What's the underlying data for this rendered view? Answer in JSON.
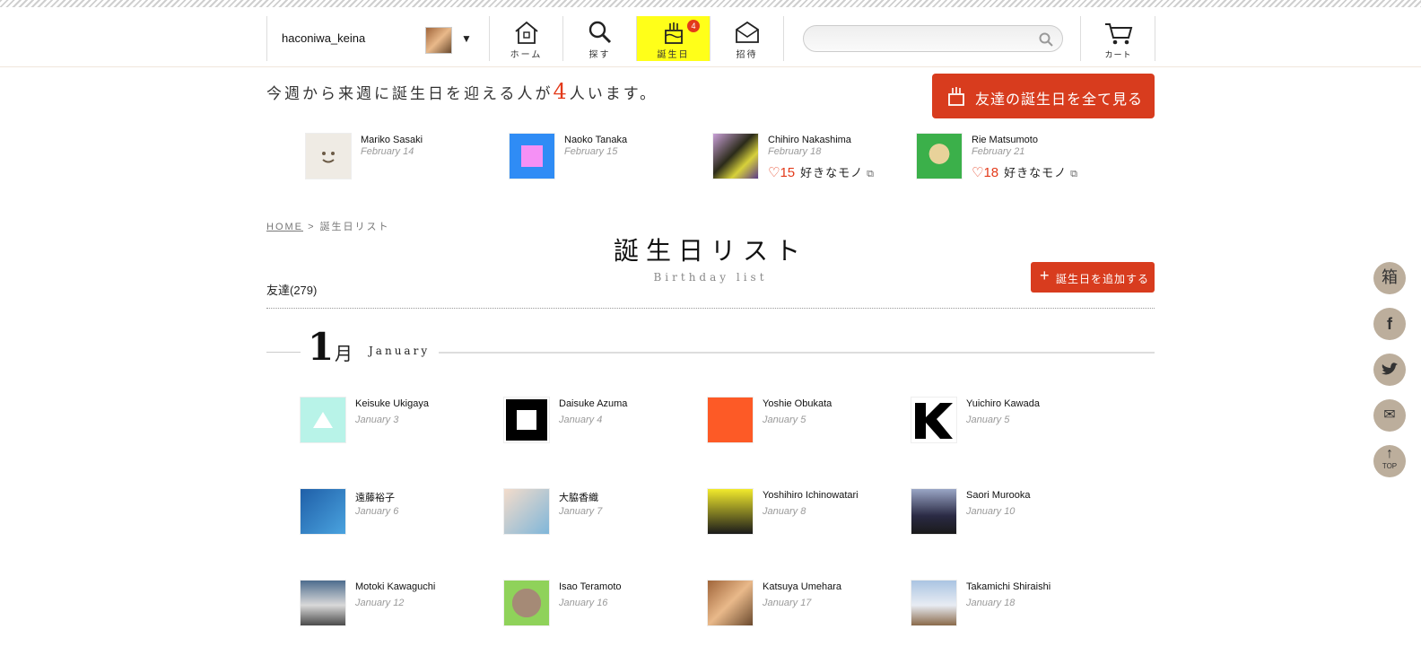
{
  "header": {
    "username": "haconiwa_keina",
    "nav": [
      {
        "key": "home",
        "label": "ホーム"
      },
      {
        "key": "search",
        "label": "探す"
      },
      {
        "key": "birthday",
        "label": "誕生日",
        "badge": "4"
      },
      {
        "key": "invite",
        "label": "招待"
      }
    ],
    "search_placeholder": "",
    "cart_label": "カート"
  },
  "upcoming": {
    "text_before": "今週から来週に誕生日を迎える人が",
    "count": "4",
    "text_after": "人います。",
    "all_button": "友達の誕生日を全て見る",
    "like_label": "好きなモノ",
    "friends": [
      {
        "name": "Mariko Sasaki",
        "date": "February 14",
        "likes": null
      },
      {
        "name": "Naoko Tanaka",
        "date": "February 15",
        "likes": null
      },
      {
        "name": "Chihiro Nakashima",
        "date": "February 18",
        "likes": "♡15"
      },
      {
        "name": "Rie Matsumoto",
        "date": "February 21",
        "likes": "♡18"
      }
    ]
  },
  "breadcrumb": {
    "home": "HOME",
    "sep": ">",
    "current": "誕生日リスト"
  },
  "page": {
    "title": "誕生日リスト",
    "subtitle": "Birthday list",
    "add_button": "誕生日を追加する",
    "friends_count": "友達(279)"
  },
  "month": {
    "num": "1",
    "kanji": "月",
    "en": "January"
  },
  "list": [
    {
      "name": "Keisuke Ukigaya",
      "date": "January 3"
    },
    {
      "name": "Daisuke Azuma",
      "date": "January 4"
    },
    {
      "name": "Yoshie Obukata",
      "date": "January 5"
    },
    {
      "name": "Yuichiro Kawada",
      "date": "January 5"
    },
    {
      "name": "遠藤裕子",
      "date": "January 6"
    },
    {
      "name": "大脇香織",
      "date": "January 7"
    },
    {
      "name": "Yoshihiro Ichinowatari",
      "date": "January 8"
    },
    {
      "name": "Saori Murooka",
      "date": "January 10"
    },
    {
      "name": "Motoki Kawaguchi",
      "date": "January 12"
    },
    {
      "name": "Isao Teramoto",
      "date": "January 16"
    },
    {
      "name": "Katsuya Umehara",
      "date": "January 17"
    },
    {
      "name": "Takamichi Shiraishi",
      "date": "January 18"
    }
  ],
  "sidebar": {
    "box": "箱",
    "facebook": "f",
    "twitter": "t",
    "mail": "✉",
    "top": "TOP"
  },
  "colors": {
    "accent": "#d83c1e",
    "highlight": "#ffff19"
  }
}
